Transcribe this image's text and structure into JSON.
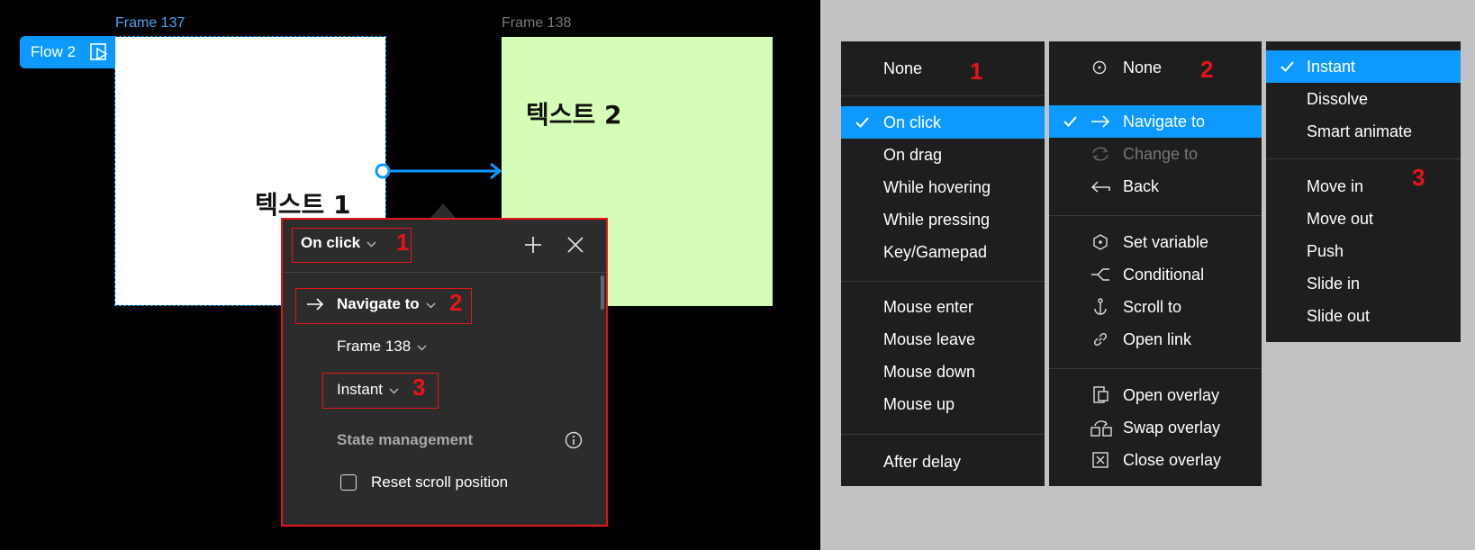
{
  "canvas": {
    "frame137_label": "Frame 137",
    "frame138_label": "Frame 138",
    "flow_badge": "Flow 2",
    "frame137_text": "텍스트 1",
    "frame138_text": "텍스트 2"
  },
  "panel": {
    "trigger": "On click",
    "action": "Navigate to",
    "destination": "Frame 138",
    "animation": "Instant",
    "state_management": "State management",
    "reset_scroll": "Reset scroll position",
    "reset_scroll_checked": false
  },
  "markers": {
    "one": "1",
    "two": "2",
    "three": "3"
  },
  "trigger_menu": {
    "items": [
      "None",
      "On click",
      "On drag",
      "While hovering",
      "While pressing",
      "Key/Gamepad",
      "Mouse enter",
      "Mouse leave",
      "Mouse down",
      "Mouse up",
      "After delay"
    ],
    "selected": "On click"
  },
  "action_menu": {
    "items": [
      "None",
      "Navigate to",
      "Change to",
      "Back",
      "Set variable",
      "Conditional",
      "Scroll to",
      "Open link",
      "Open overlay",
      "Swap overlay",
      "Close overlay"
    ],
    "selected": "Navigate to",
    "disabled": [
      "Change to"
    ]
  },
  "animation_menu": {
    "items": [
      "Instant",
      "Dissolve",
      "Smart animate",
      "Move in",
      "Move out",
      "Push",
      "Slide in",
      "Slide out"
    ],
    "selected": "Instant"
  },
  "colors": {
    "accent": "#0d99ff",
    "highlight_red": "#e8131b",
    "frame138_bg": "#d6fdb8",
    "menu_bg": "#1e1e1e"
  }
}
